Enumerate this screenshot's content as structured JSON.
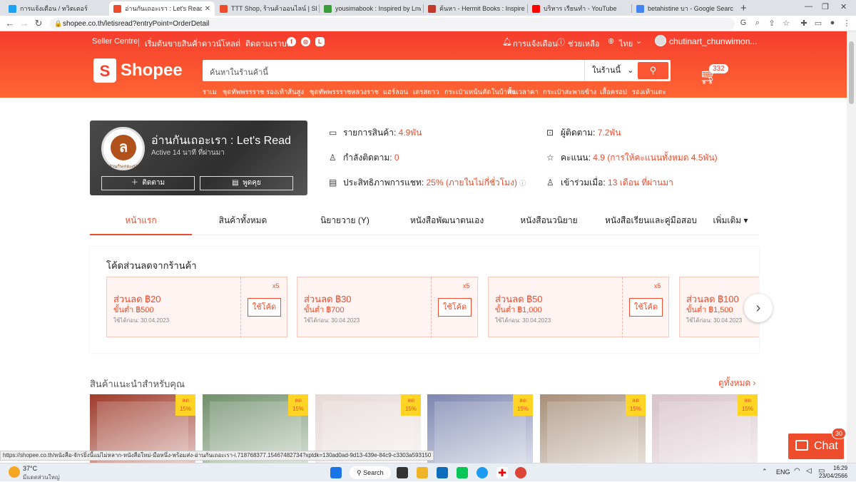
{
  "browser": {
    "tabs": [
      {
        "title": "การแจ้งเตือน / ทวิตเตอร์",
        "color": "#1da1f2",
        "active": false
      },
      {
        "title": "อ่านกันเถอะเรา : Let's Read, ร้านค้าออนไลน์",
        "color": "#ee4d2d",
        "active": true
      },
      {
        "title": "TTT Shop, ร้านค้าออนไลน์ | Shopee",
        "color": "#ee4d2d",
        "active": false
      },
      {
        "title": "yousimabook : Inspired by LnwS",
        "color": "#3a9b3a",
        "active": false
      },
      {
        "title": "ค้นหา - Hermit Books : Inspired",
        "color": "#c0392b",
        "active": false
      },
      {
        "title": "บริหาร เรียนทำ - YouTube",
        "color": "#ff0000",
        "active": false
      },
      {
        "title": "betahistine บา - Google Search",
        "color": "#4285f4",
        "active": false
      }
    ],
    "url": "shopee.co.th/letisread?entryPoint=OrderDetail",
    "status_url": "https://shopee.co.th/หนังสือ-จักรยิ่งนี้แม่ไม่หลาก-หนังสือใหม่-มือหนึ่ง-พร้อมส่ง-อ่านกันเถอะเรา-i.718768377.15467482734?xptdk=130ad0ad-9d13-439e-84c9-c3303a593150"
  },
  "header": {
    "topnav": [
      "Seller Centre",
      "เริ่มต้นขายสินค้า",
      "ดาวน์โหลด",
      "ติดตามเราบน"
    ],
    "notifications": "การแจ้งเตือน",
    "help": "ช่วยเหลือ",
    "language": "ไทย",
    "username": "chutinart_chunwimon...",
    "logo_text": "Shopee",
    "search_placeholder": "ค้นหาในร้านค้านี้",
    "search_scope": "ในร้านนี้",
    "suggestions": [
      "ราเม",
      "ชุดทัพพรรราช",
      "รองเท้าส้นสูง",
      "ชุดทัพพรรราช",
      "หลวงราช",
      "แฮร์ลอน",
      "เดรสยาว",
      "กระเป๋าเหน้นคัดในบ้าทั่ง",
      "ลิ้นเวลาคา",
      "กระเป๋าสะพายข้าง",
      "เสื้อครอป",
      "รองเท้าแตะ"
    ],
    "cart_count": "332"
  },
  "shop": {
    "name": "อ่านกันเถอะเรา : Let's Read",
    "active": "Active 14 นาที ที่ผ่านมา",
    "avatar_caption": "อ่านกันเถอะเรา",
    "follow_label": "ติดตาม",
    "chat_label": "พูดคุย",
    "stats": [
      {
        "label": "รายการสินค้า:",
        "value": "4.9พัน"
      },
      {
        "label": "ผู้ติดตาม:",
        "value": "7.2พัน"
      },
      {
        "label": "กำลังติดตาม:",
        "value": "0"
      },
      {
        "label": "คะแนน:",
        "value": "4.9 (การให้คะแนนทั้งหมด 4.5พัน)"
      },
      {
        "label": "ประสิทธิภาพการแชท:",
        "value": "25% (ภายในไม่กี่ชั่วโมง)"
      },
      {
        "label": "เข้าร่วมเมื่อ:",
        "value": "13 เดือน ที่ผ่านมา"
      }
    ]
  },
  "tabs": [
    "หน้าแรก",
    "สินค้าทั้งหมด",
    "นิยายวาย (Y)",
    "หนังสือพัฒนาตนเอง",
    "หนังสือนวนิยาย",
    "หนังสือเรียนและคู่มือสอบ",
    "เพิ่มเติม"
  ],
  "vouchers": {
    "title": "โค้ดส่วนลดจากร้านค้า",
    "items": [
      {
        "discount": "ส่วนลด ฿20",
        "min": "ขั้นต่ำ ฿500",
        "expiry": "ใช้ได้ก่อน: 30.04.2023",
        "qty": "x5",
        "button": "ใช้โค้ด"
      },
      {
        "discount": "ส่วนลด ฿30",
        "min": "ขั้นต่ำ ฿700",
        "expiry": "ใช้ได้ก่อน: 30.04.2023",
        "qty": "x5",
        "button": "ใช้โค้ด"
      },
      {
        "discount": "ส่วนลด ฿50",
        "min": "ขั้นต่ำ ฿1,000",
        "expiry": "ใช้ได้ก่อน: 30.04.2023",
        "qty": "x5",
        "button": "ใช้โค้ด"
      },
      {
        "discount": "ส่วนลด ฿100",
        "min": "ขั้นต่ำ ฿1,500",
        "expiry": "ใช้ได้ก่อน: 30.04.2023",
        "qty": "",
        "button": ""
      }
    ]
  },
  "recommend": {
    "title": "สินค้าแนะนำสำหรับคุณ",
    "see_all": "ดูทั้งหมด",
    "badge_label": "ลด",
    "badge_pct": "15%",
    "product_colors": [
      "#9e3a2a",
      "#6f8f6a",
      "#e6d9d6",
      "#7c86b0",
      "#a88f78",
      "#d7c2c9"
    ]
  },
  "chat": {
    "label": "Chat",
    "badge": "30"
  },
  "taskbar": {
    "weather_temp": "37°C",
    "weather_desc": "มีแดดส่วนใหญ่",
    "search": "Search",
    "lang": "ENG",
    "time": "16:29",
    "date": "23/04/2566"
  }
}
